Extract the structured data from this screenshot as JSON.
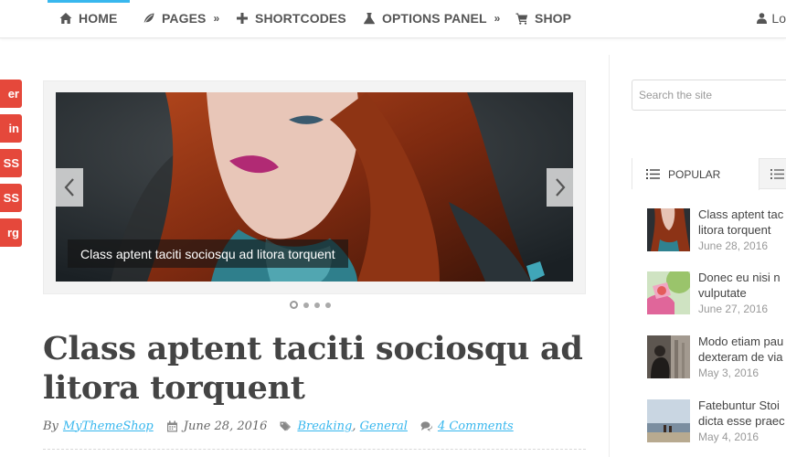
{
  "nav": {
    "items": [
      {
        "label": "HOME",
        "icon": "home-icon"
      },
      {
        "label": "PAGES",
        "icon": "leaf-icon",
        "submenu": true
      },
      {
        "label": "SHORTCODES",
        "icon": "plus-icon"
      },
      {
        "label": "OPTIONS PANEL",
        "icon": "flask-icon",
        "submenu": true
      },
      {
        "label": "SHOP",
        "icon": "cart-icon"
      }
    ],
    "login_label": "Lo",
    "submenu_glyph": "»"
  },
  "share": {
    "buttons": [
      "er",
      "in",
      "SS",
      "SS",
      "rg"
    ]
  },
  "slider": {
    "caption": "Class aptent taciti sociosqu ad litora torquent",
    "active_slide": 1,
    "slide_count": 4
  },
  "post": {
    "title": "Class aptent taciti sociosqu ad litora torquent",
    "by_label": "By",
    "author": "MyThemeShop",
    "date": "June 28, 2016",
    "categories": [
      "Breaking",
      "General"
    ],
    "comments": "4 Comments"
  },
  "sidebar": {
    "search_placeholder": "Search the site",
    "tabs": {
      "popular": "POPULAR"
    },
    "popular": [
      {
        "title_line1": "Class aptent tac",
        "title_line2": "litora torquent",
        "date": "June 28, 2016"
      },
      {
        "title_line1": "Donec eu nisi n",
        "title_line2": "vulputate",
        "date": "June 27, 2016"
      },
      {
        "title_line1": "Modo etiam pau",
        "title_line2": "dexteram de via",
        "date": "May 3, 2016"
      },
      {
        "title_line1": "Fatebuntur Stoi",
        "title_line2": "dicta esse praec",
        "date": "May 4, 2016"
      }
    ]
  },
  "colors": {
    "accent": "#38b7ee",
    "share_red": "#e5483b",
    "text": "#444444"
  }
}
